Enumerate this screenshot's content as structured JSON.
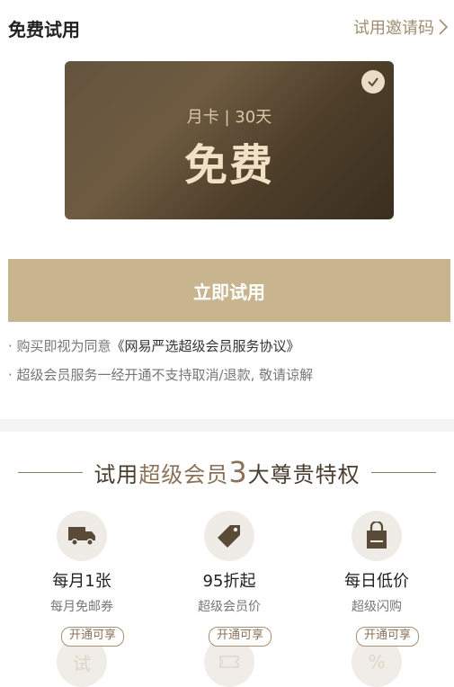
{
  "header": {
    "title": "免费试用",
    "invite_label": "试用邀请码"
  },
  "card": {
    "subtitle": "月卡 | 30天",
    "price_label": "免费"
  },
  "cta": {
    "label": "立即试用"
  },
  "notes": {
    "line1_prefix": "· 购买即视为同意",
    "line1_link": "《网易严选超级会员服务协议》",
    "line2": "· 超级会员服务一经开通不支持取消/退款, 敬请谅解"
  },
  "privileges": {
    "title_part1": "试用",
    "title_part2": "超级会员",
    "title_num": "3",
    "title_part3": "大尊贵特权",
    "items": [
      {
        "icon": "truck-icon",
        "name": "每月1张",
        "desc": "每月免邮券"
      },
      {
        "icon": "tag-icon",
        "name": "95折起",
        "desc": "超级会员价"
      },
      {
        "icon": "shopping-bag-icon",
        "name": "每日低价",
        "desc": "超级闪购"
      }
    ],
    "badges": [
      "开通可享",
      "开通可享",
      "开通可享"
    ],
    "lower_glyphs": [
      "试",
      "",
      "%"
    ]
  },
  "colors": {
    "accent": "#c8b58f",
    "card_dark": "#4f3f2b",
    "icon_brown": "#5a4a38"
  }
}
